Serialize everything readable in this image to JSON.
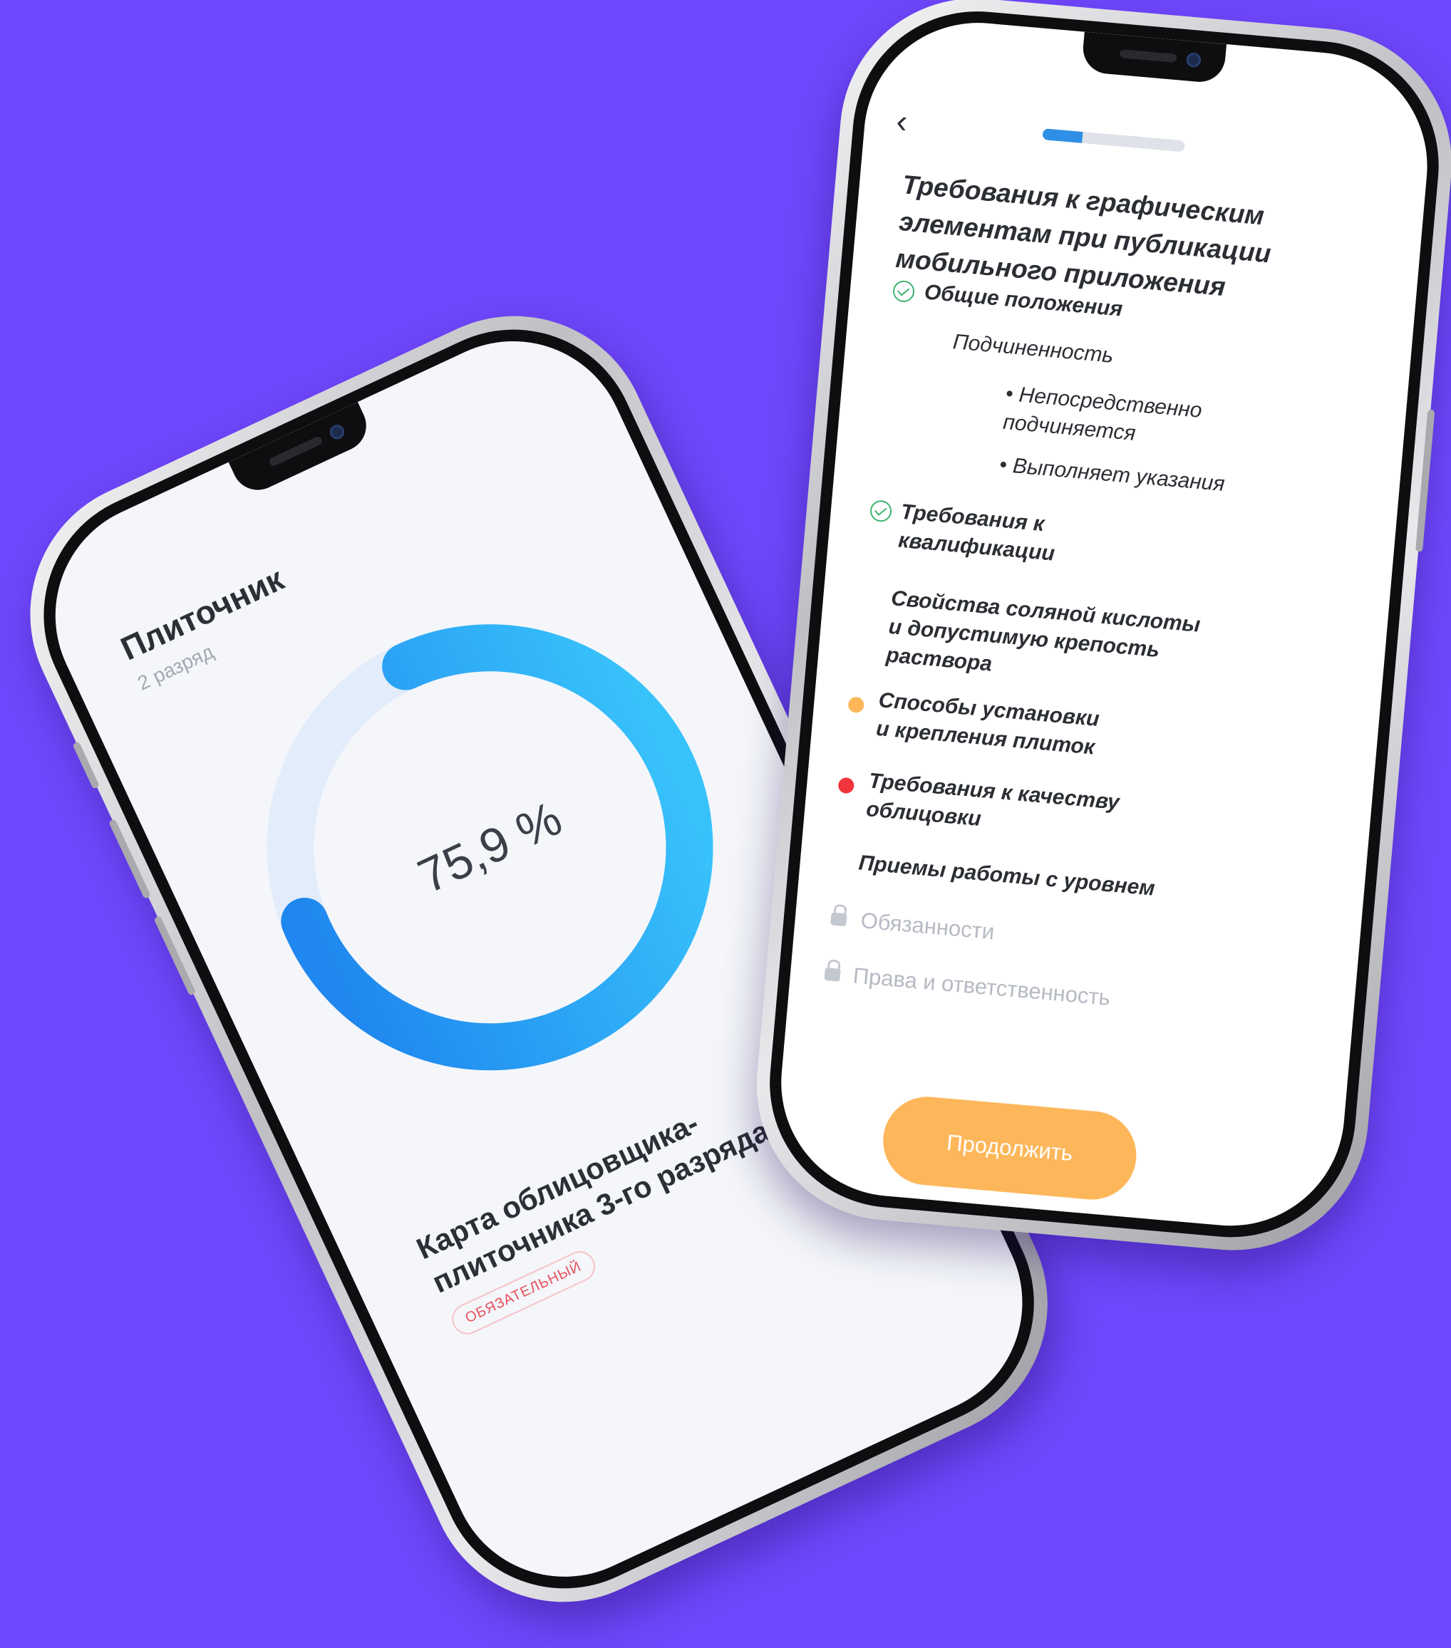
{
  "left_screen": {
    "profession": "Плиточник",
    "grade": "2 разряд",
    "progress_label": "75,9 %",
    "progress_value": 0.759,
    "card_title": "Карта облицовщика-плиточника 3-го разряда",
    "badge": "ОБЯЗАТЕЛЬНЫЙ"
  },
  "right_screen": {
    "back_icon": "chevron-left-icon",
    "step_progress": 0.28,
    "title": "Требования к графическим элементам при публикации мобильного приложения",
    "items": [
      {
        "label": "Общие положения",
        "status": "done"
      },
      {
        "label": "Подчиненность",
        "status": "none"
      },
      {
        "label": "• Непосредственно подчиняется",
        "status": "none"
      },
      {
        "label": "• Выполняет указания",
        "status": "none"
      },
      {
        "label": "Требования к квалификации",
        "status": "done"
      },
      {
        "label": "Свойства соляной кислоты и допустимую крепость раствора",
        "status": "none"
      },
      {
        "label": "Способы установки и крепления плиток",
        "status": "in-progress"
      },
      {
        "label": "Требования к качеству облицовки",
        "status": "failed"
      },
      {
        "label": "Приемы работы с уровнем",
        "status": "none"
      },
      {
        "label": "Обязанности",
        "status": "locked"
      },
      {
        "label": "Права и ответственность",
        "status": "locked"
      }
    ],
    "continue_button": "Продолжить"
  },
  "colors": {
    "background": "#6f47fc",
    "ring_blue": "#2f8fe6",
    "ring_track": "#e3ecfb",
    "done_green": "#3fb471",
    "in_progress_orange": "#fdb75a",
    "failed_red": "#f2343c",
    "button_orange": "#fdb75a"
  }
}
